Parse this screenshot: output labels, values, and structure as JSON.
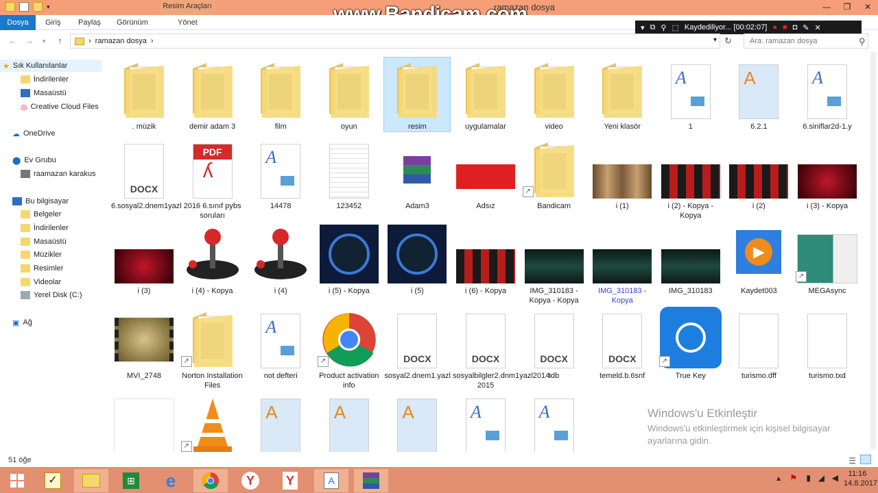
{
  "window": {
    "title": "ramazan dosya",
    "contextual_tab": "Resim Araçları",
    "controls": [
      "—",
      "❐",
      "✕"
    ]
  },
  "ribbon": {
    "tabs": [
      "Dosya",
      "Giriş",
      "Paylaş",
      "Görünüm",
      "Yönet"
    ]
  },
  "watermark": "www.Bandicam.com",
  "recorder": {
    "status": "Kaydediliyor... [00:02:07]"
  },
  "address": {
    "path": "ramazan dosya",
    "search_placeholder": "Ara: ramazan dosya"
  },
  "sidebar": {
    "items": [
      {
        "label": "Sık Kullanılanlar",
        "icon": "star-icon"
      },
      {
        "label": "İndirilenler",
        "icon": "folder-icon"
      },
      {
        "label": "Masaüstü",
        "icon": "desktop-icon"
      },
      {
        "label": "Creative Cloud Files",
        "icon": "creative-cloud-icon"
      },
      {
        "label": "OneDrive",
        "icon": "cloud-icon"
      },
      {
        "label": "Ev Grubu",
        "icon": "homegroup-icon"
      },
      {
        "label": "raamazan karakus",
        "icon": "user-icon"
      },
      {
        "label": "Bu bilgisayar",
        "icon": "computer-icon"
      },
      {
        "label": "Belgeler",
        "icon": "folder-icon"
      },
      {
        "label": "İndirilenler",
        "icon": "folder-icon"
      },
      {
        "label": "Masaüstü",
        "icon": "folder-icon"
      },
      {
        "label": "Müzikler",
        "icon": "folder-icon"
      },
      {
        "label": "Resimler",
        "icon": "folder-icon"
      },
      {
        "label": "Videolar",
        "icon": "folder-icon"
      },
      {
        "label": "Yerel Disk (C:)",
        "icon": "disk-icon"
      },
      {
        "label": "Ağ",
        "icon": "network-icon"
      }
    ]
  },
  "files": [
    {
      "name": ". müzik",
      "kind": "folder"
    },
    {
      "name": "demir adam 3",
      "kind": "folder"
    },
    {
      "name": "film",
      "kind": "folder"
    },
    {
      "name": "oyun",
      "kind": "folder"
    },
    {
      "name": "resim",
      "kind": "folder",
      "selected": true
    },
    {
      "name": "uygulamalar",
      "kind": "folder"
    },
    {
      "name": "video",
      "kind": "folder"
    },
    {
      "name": "Yeni klasör",
      "kind": "folder"
    },
    {
      "name": "1",
      "kind": "wordpad"
    },
    {
      "name": "6.2.1",
      "kind": "wordpad-app"
    },
    {
      "name": "6.siniflar2d-1.y",
      "kind": "wordpad"
    },
    {
      "name": "6.sosyal2.dnem1yazl",
      "kind": "docx"
    },
    {
      "name": "2016 6.sınıf pybs soruları",
      "kind": "pdf"
    },
    {
      "name": "14478",
      "kind": "wordpad"
    },
    {
      "name": "123452",
      "kind": "text"
    },
    {
      "name": "Adam3",
      "kind": "winrar"
    },
    {
      "name": "Adsız",
      "kind": "image-red"
    },
    {
      "name": "Bandicam",
      "kind": "folder-shortcut"
    },
    {
      "name": "i (1)",
      "kind": "image-strip"
    },
    {
      "name": "i (2) - Kopya - Kopya",
      "kind": "image-red-cubes"
    },
    {
      "name": "i (2)",
      "kind": "image-red-cubes"
    },
    {
      "name": "i (3) - Kopya",
      "kind": "image-dark-red"
    },
    {
      "name": "i (3)",
      "kind": "image-dark-red"
    },
    {
      "name": "i (4) - Kopya",
      "kind": "joystick"
    },
    {
      "name": "i (4)",
      "kind": "joystick"
    },
    {
      "name": "i (5) - Kopya",
      "kind": "fist"
    },
    {
      "name": "i (5)",
      "kind": "fist"
    },
    {
      "name": "i (6) - Kopya",
      "kind": "image-red-cubes"
    },
    {
      "name": "IMG_310183 - Kopya - Kopya",
      "kind": "image-wave"
    },
    {
      "name": "IMG_310183 - Kopya",
      "kind": "image-wave",
      "highlight": true
    },
    {
      "name": "IMG_310183",
      "kind": "image-wave"
    },
    {
      "name": "Kaydet003",
      "kind": "media-player"
    },
    {
      "name": "MEGAsync",
      "kind": "megasync-shortcut"
    },
    {
      "name": "MVI_2748",
      "kind": "video"
    },
    {
      "name": "Norton Installation Files",
      "kind": "folder-shortcut"
    },
    {
      "name": "not defteri",
      "kind": "wordpad"
    },
    {
      "name": "Product activation info",
      "kind": "chrome-shortcut"
    },
    {
      "name": "sosyal2.dnem1.yazl",
      "kind": "docx"
    },
    {
      "name": "sosyalbilgler2.dnm1yazl2014-2015",
      "kind": "docx"
    },
    {
      "name": "tdb",
      "kind": "docx"
    },
    {
      "name": "temeld.b.6snf",
      "kind": "docx"
    },
    {
      "name": "True Key",
      "kind": "truekey-shortcut"
    },
    {
      "name": "turismo.dff",
      "kind": "blank"
    },
    {
      "name": "turismo.txd",
      "kind": "blank"
    },
    {
      "name": "",
      "kind": "blank-small"
    },
    {
      "name": "",
      "kind": "vlc-shortcut"
    },
    {
      "name": "",
      "kind": "wordpad-app"
    },
    {
      "name": "",
      "kind": "wordpad-app"
    },
    {
      "name": "",
      "kind": "wordpad-app"
    },
    {
      "name": "",
      "kind": "wordpad"
    },
    {
      "name": "",
      "kind": "wordpad"
    }
  ],
  "status": {
    "count": "51 öğe"
  },
  "activation": {
    "title": "Windows'u Etkinleştir",
    "body": "Windows'u etkinleştirmek için kişisel bilgisayar ayarlarına gidin."
  },
  "taskbar": {
    "time": "11:16",
    "date": "14.8.2017"
  },
  "colors": {
    "titlebar": "#f59e77",
    "file_tab": "#1979ca",
    "taskbar": "#e28f72",
    "selection": "#cce8ff"
  }
}
